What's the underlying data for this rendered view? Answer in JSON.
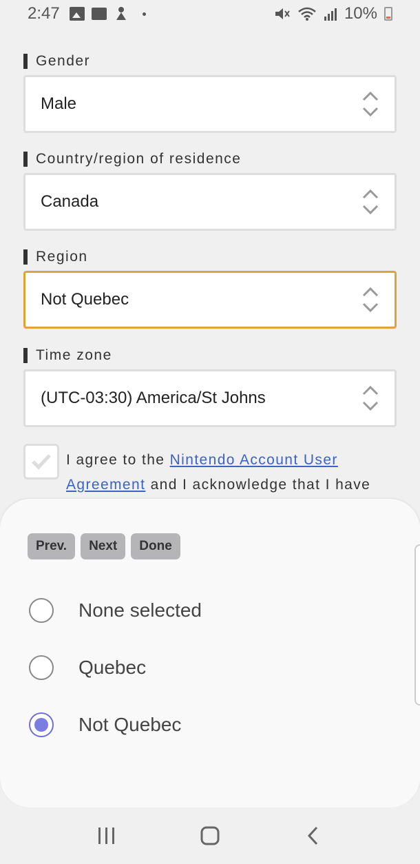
{
  "status_bar": {
    "time": "2:47",
    "battery": "10%",
    "icons": [
      "image-icon",
      "gmail-icon",
      "notification-icon",
      "mute-icon",
      "wifi-icon",
      "signal-icon",
      "battery-icon"
    ]
  },
  "form": {
    "fields": [
      {
        "label": "Gender",
        "value": "Male"
      },
      {
        "label": "Country/region of residence",
        "value": "Canada"
      },
      {
        "label": "Region",
        "value": "Not Quebec"
      },
      {
        "label": "Time zone",
        "value": "(UTC-03:30) America/St Johns"
      }
    ],
    "agreement": {
      "prefix": "I agree to the",
      "link": "Nintendo Account User Agreement",
      "suffix": "and I acknowledge that I have",
      "checked": false
    }
  },
  "picker": {
    "buttons": {
      "prev": "Prev.",
      "next": "Next",
      "done": "Done"
    },
    "options": [
      {
        "label": "None selected",
        "selected": false
      },
      {
        "label": "Quebec",
        "selected": false
      },
      {
        "label": "Not Quebec",
        "selected": true
      }
    ]
  },
  "colors": {
    "focus_border": "#e0a33a",
    "link": "#3b62c7",
    "radio_selected": "#7b7de3"
  }
}
